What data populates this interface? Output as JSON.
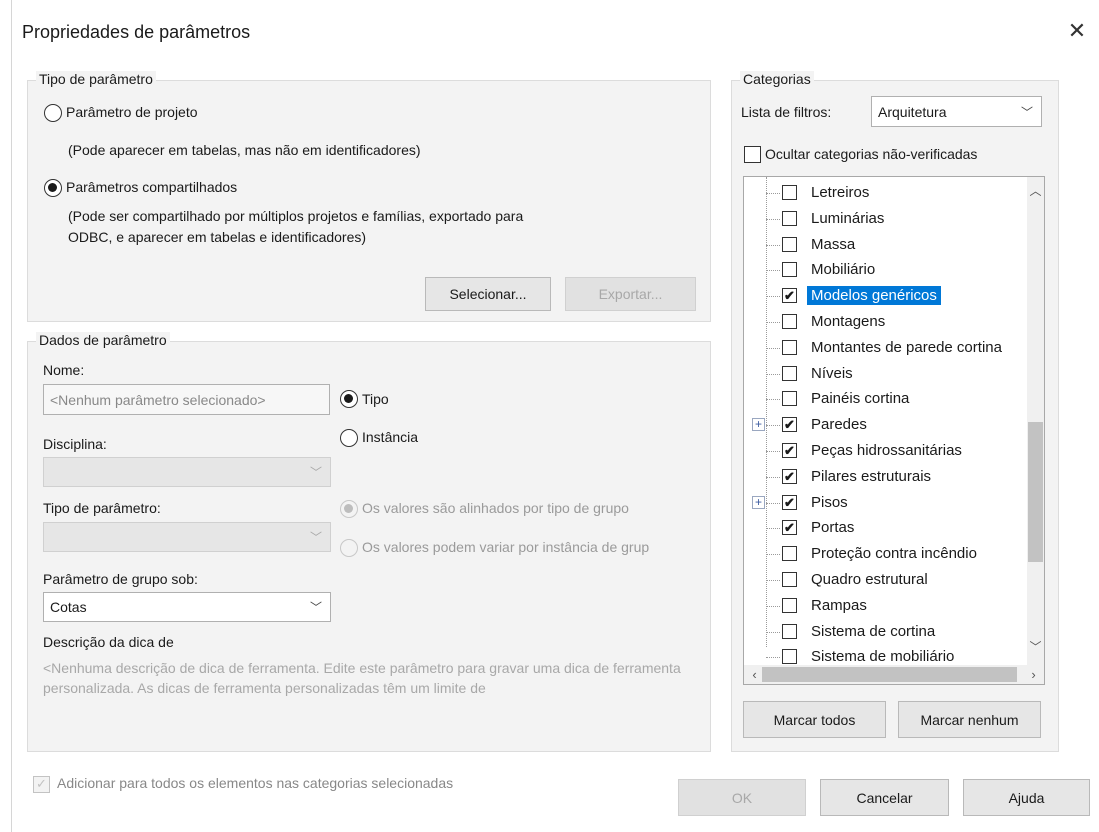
{
  "window": {
    "title": "Propriedades de parâmetros"
  },
  "param_type": {
    "legend": "Tipo de parâmetro",
    "project_label": "Parâmetro de projeto",
    "project_desc": "(Pode aparecer em tabelas, mas não em identificadores)",
    "shared_label": "Parâmetros compartilhados",
    "shared_desc_line1": "(Pode ser compartilhado por múltiplos projetos e famílias, exportado para",
    "shared_desc_line2": "ODBC, e aparecer em tabelas e identificadores)",
    "select_label": "Selecionar...",
    "export_label": "Exportar...",
    "selected": "shared"
  },
  "param_data": {
    "legend": "Dados de parâmetro",
    "name_label": "Nome:",
    "name_placeholder": "<Nenhum parâmetro selecionado>",
    "type_label": "Tipo",
    "instance_label": "Instância",
    "discipline_label": "Disciplina:",
    "discipline_value": "",
    "param_type_label": "Tipo de parâmetro:",
    "param_type_value": "",
    "aligned_label": "Os valores são alinhados por tipo de grupo",
    "vary_label": "Os valores podem variar por instância de grup",
    "group_under_label": "Parâmetro de grupo sob:",
    "group_under_value": "Cotas",
    "tooltip_label": "Descrição da dica de",
    "tooltip_text": "<Nenhuma descrição de dica de ferramenta. Edite este parâmetro para gravar uma dica de ferramenta personalizada. As dicas de ferramenta personalizadas têm um limite de"
  },
  "categories": {
    "legend": "Categorias",
    "filter_label": "Lista de filtros:",
    "filter_value": "Arquitetura",
    "hide_unchecked_label": "Ocultar categorias não-verificadas",
    "items": [
      {
        "label": "Letreiros",
        "checked": false,
        "expander": false
      },
      {
        "label": "Luminárias",
        "checked": false,
        "expander": false
      },
      {
        "label": "Massa",
        "checked": false,
        "expander": false
      },
      {
        "label": "Mobiliário",
        "checked": false,
        "expander": false
      },
      {
        "label": "Modelos genéricos",
        "checked": true,
        "expander": false,
        "selected": true
      },
      {
        "label": "Montagens",
        "checked": false,
        "expander": false
      },
      {
        "label": "Montantes de parede cortina",
        "checked": false,
        "expander": false
      },
      {
        "label": "Níveis",
        "checked": false,
        "expander": false
      },
      {
        "label": "Painéis cortina",
        "checked": false,
        "expander": false
      },
      {
        "label": "Paredes",
        "checked": true,
        "expander": true
      },
      {
        "label": "Peças hidrossanitárias",
        "checked": true,
        "expander": false
      },
      {
        "label": "Pilares estruturais",
        "checked": true,
        "expander": false
      },
      {
        "label": "Pisos",
        "checked": true,
        "expander": true
      },
      {
        "label": "Portas",
        "checked": true,
        "expander": false
      },
      {
        "label": "Proteção contra incêndio",
        "checked": false,
        "expander": false
      },
      {
        "label": "Quadro estrutural",
        "checked": false,
        "expander": false
      },
      {
        "label": "Rampas",
        "checked": false,
        "expander": false
      },
      {
        "label": "Sistema de cortina",
        "checked": false,
        "expander": false
      },
      {
        "label": "Sistema de mobiliário",
        "checked": false,
        "expander": false
      }
    ],
    "check_all_label": "Marcar todos",
    "check_none_label": "Marcar nenhum"
  },
  "footer": {
    "add_all_label": "Adicionar para todos os elementos nas categorias selecionadas",
    "ok_label": "OK",
    "cancel_label": "Cancelar",
    "help_label": "Ajuda"
  },
  "colors": {
    "selection": "#0078d7",
    "panel": "#f3f3f3"
  }
}
